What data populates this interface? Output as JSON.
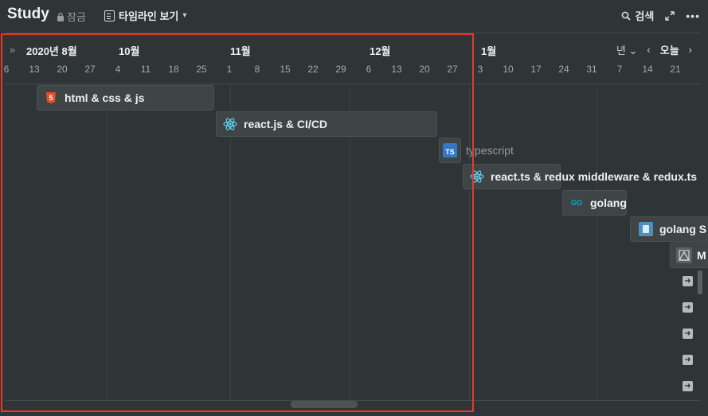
{
  "header": {
    "title": "Study",
    "lock_label": "잠금",
    "view_label": "타임라인 보기",
    "search_label": "검색"
  },
  "timeline": {
    "months": [
      "2020년 8월",
      "10월",
      "11월",
      "12월",
      "1월"
    ],
    "days": [
      "6",
      "13",
      "20",
      "27",
      "4",
      "11",
      "18",
      "25",
      "1",
      "8",
      "15",
      "22",
      "29",
      "6",
      "13",
      "20",
      "27",
      "3",
      "10",
      "17",
      "24",
      "31",
      "7",
      "14",
      "21"
    ],
    "zoom_label": "년",
    "today_label": "오늘"
  },
  "items": [
    {
      "label": "html & css & js",
      "icon": "html5-icon"
    },
    {
      "label": "react.js & CI/CD",
      "icon": "react-icon"
    },
    {
      "label": "typescript",
      "icon": "typescript-icon"
    },
    {
      "label": "react.ts & redux middleware & redux.ts",
      "icon": "react-icon"
    },
    {
      "label": "golang",
      "icon": "golang-icon"
    },
    {
      "label": "golang S",
      "icon": "golang-doc-icon"
    },
    {
      "label": "M",
      "icon": "page-icon"
    }
  ],
  "colors": {
    "background": "#2f3437",
    "bar": "#3f4447",
    "selection": "#e23b2b"
  }
}
